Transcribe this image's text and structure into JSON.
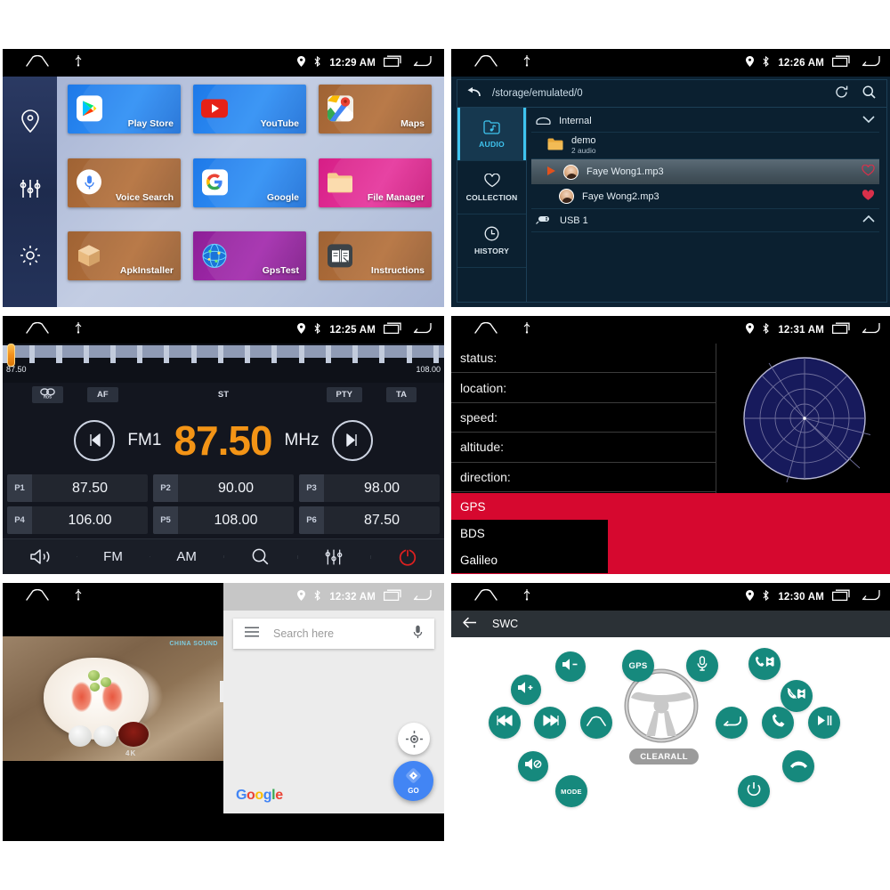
{
  "panels": {
    "launcher": {
      "status": {
        "time": "12:29 AM"
      },
      "rail": [
        {
          "name": "navigation-pin-icon",
          "label": "Navigation"
        },
        {
          "name": "equalizer-icon",
          "label": "Equalizer"
        },
        {
          "name": "settings-gear-icon",
          "label": "Settings"
        }
      ],
      "apps": [
        {
          "label": "Play Store",
          "icon": "play-store-icon",
          "color": "blue"
        },
        {
          "label": "YouTube",
          "icon": "youtube-icon",
          "color": "blue"
        },
        {
          "label": "Maps",
          "icon": "google-maps-icon",
          "color": "brown"
        },
        {
          "label": "Voice Search",
          "icon": "microphone-icon",
          "color": "brown"
        },
        {
          "label": "Google",
          "icon": "google-g-icon",
          "color": "blue"
        },
        {
          "label": "File Manager",
          "icon": "folder-icon",
          "color": "pink"
        },
        {
          "label": "ApkInstaller",
          "icon": "package-box-icon",
          "color": "brown"
        },
        {
          "label": "GpsTest",
          "icon": "globe-icon",
          "color": "purple"
        },
        {
          "label": "Instructions",
          "icon": "open-book-icon",
          "color": "brown"
        }
      ]
    },
    "filebrowser": {
      "status": {
        "time": "12:26 AM"
      },
      "path": "/storage/emulated/0",
      "actions": [
        {
          "name": "refresh-icon",
          "label": "Refresh"
        },
        {
          "name": "search-icon",
          "label": "Search"
        }
      ],
      "tabs": [
        {
          "label": "AUDIO",
          "icon": "audio-folder-icon",
          "active": true
        },
        {
          "label": "COLLECTION",
          "icon": "heart-icon",
          "active": false
        },
        {
          "label": "HISTORY",
          "icon": "clock-icon",
          "active": false
        }
      ],
      "rows": [
        {
          "type": "storage",
          "label": "Internal",
          "icon": "internal-storage-icon",
          "chevron": "chevron-down"
        },
        {
          "type": "folder",
          "label": "demo",
          "sub": "2 audio",
          "icon": "folder-icon"
        },
        {
          "type": "track",
          "label": "Faye Wong1.mp3",
          "playing": true,
          "favorite": false
        },
        {
          "type": "track",
          "label": "Faye Wong2.mp3",
          "playing": false,
          "favorite": true
        },
        {
          "type": "storage",
          "label": "USB 1",
          "icon": "usb-icon",
          "chevron": "chevron-up"
        }
      ]
    },
    "radio": {
      "status": {
        "time": "12:25 AM"
      },
      "scale": {
        "min": "87.50",
        "max": "108.00"
      },
      "badges": {
        "rds": "RDS",
        "af": "AF",
        "st": "ST",
        "pty": "PTY",
        "ta": "TA"
      },
      "band": "FM1",
      "frequency": "87.50",
      "unit": "MHz",
      "prev_label": "prev-station",
      "next_label": "next-station",
      "presets": [
        {
          "slot": "P1",
          "value": "87.50"
        },
        {
          "slot": "P2",
          "value": "90.00"
        },
        {
          "slot": "P3",
          "value": "98.00"
        },
        {
          "slot": "P4",
          "value": "106.00"
        },
        {
          "slot": "P5",
          "value": "108.00"
        },
        {
          "slot": "P6",
          "value": "87.50"
        }
      ],
      "toolbar": [
        {
          "label": "",
          "icon": "mute-speaker-icon"
        },
        {
          "label": "FM",
          "icon": ""
        },
        {
          "label": "AM",
          "icon": ""
        },
        {
          "label": "",
          "icon": "search-icon"
        },
        {
          "label": "",
          "icon": "equalizer-icon"
        },
        {
          "label": "",
          "icon": "power-icon"
        }
      ]
    },
    "gps": {
      "status": {
        "time": "12:31 AM"
      },
      "fields": [
        {
          "label": "status:",
          "value": ""
        },
        {
          "label": "location:",
          "value": ""
        },
        {
          "label": "speed:",
          "value": ""
        },
        {
          "label": "altitude:",
          "value": ""
        },
        {
          "label": "direction:",
          "value": ""
        }
      ],
      "selected": "GPS",
      "options": [
        "BDS",
        "Galileo"
      ],
      "accent": "#d6082f",
      "sky_color": "#171a5c"
    },
    "video_maps": {
      "status": {
        "time": "12:32 AM"
      },
      "video": {
        "watermark_top": "CHINA SOUND",
        "watermark_bottom": "4K"
      },
      "search": {
        "placeholder": "Search here"
      },
      "icons": {
        "menu": "hamburger-menu-icon",
        "mic": "microphone-icon",
        "locate": "my-location-icon",
        "go": "navigation-arrow-icon"
      },
      "go_label": "GO",
      "brand": "Google"
    },
    "swc": {
      "status": {
        "time": "12:30 AM"
      },
      "title": "SWC",
      "back_icon": "arrow-back-icon",
      "clear_all": "CLEARALL",
      "buttons": [
        {
          "name": "volume-down-button",
          "icon": "volume-down-icon",
          "label": ""
        },
        {
          "name": "gps-button",
          "icon": "",
          "label": "GPS"
        },
        {
          "name": "voice-button",
          "icon": "microphone-icon",
          "label": ""
        },
        {
          "name": "phone-prev-button",
          "icon": "phone-prev-icon",
          "label": ""
        },
        {
          "name": "volume-up-button",
          "icon": "volume-up-icon",
          "label": ""
        },
        {
          "name": "phone-next-button",
          "icon": "phone-next-icon",
          "label": ""
        },
        {
          "name": "previous-track-button",
          "icon": "previous-track-icon",
          "label": ""
        },
        {
          "name": "next-track-button",
          "icon": "next-track-icon",
          "label": ""
        },
        {
          "name": "home-button",
          "icon": "home-icon",
          "label": ""
        },
        {
          "name": "back-button",
          "icon": "back-arrow-icon",
          "label": ""
        },
        {
          "name": "answer-call-button",
          "icon": "phone-answer-icon",
          "label": ""
        },
        {
          "name": "play-pause-button",
          "icon": "play-pause-icon",
          "label": ""
        },
        {
          "name": "mute-button",
          "icon": "mute-icon",
          "label": ""
        },
        {
          "name": "mode-button",
          "icon": "",
          "label": "MODE"
        },
        {
          "name": "hangup-button",
          "icon": "phone-hangup-icon",
          "label": ""
        },
        {
          "name": "power-button",
          "icon": "power-icon",
          "label": ""
        }
      ],
      "accent": "#16897d"
    }
  }
}
